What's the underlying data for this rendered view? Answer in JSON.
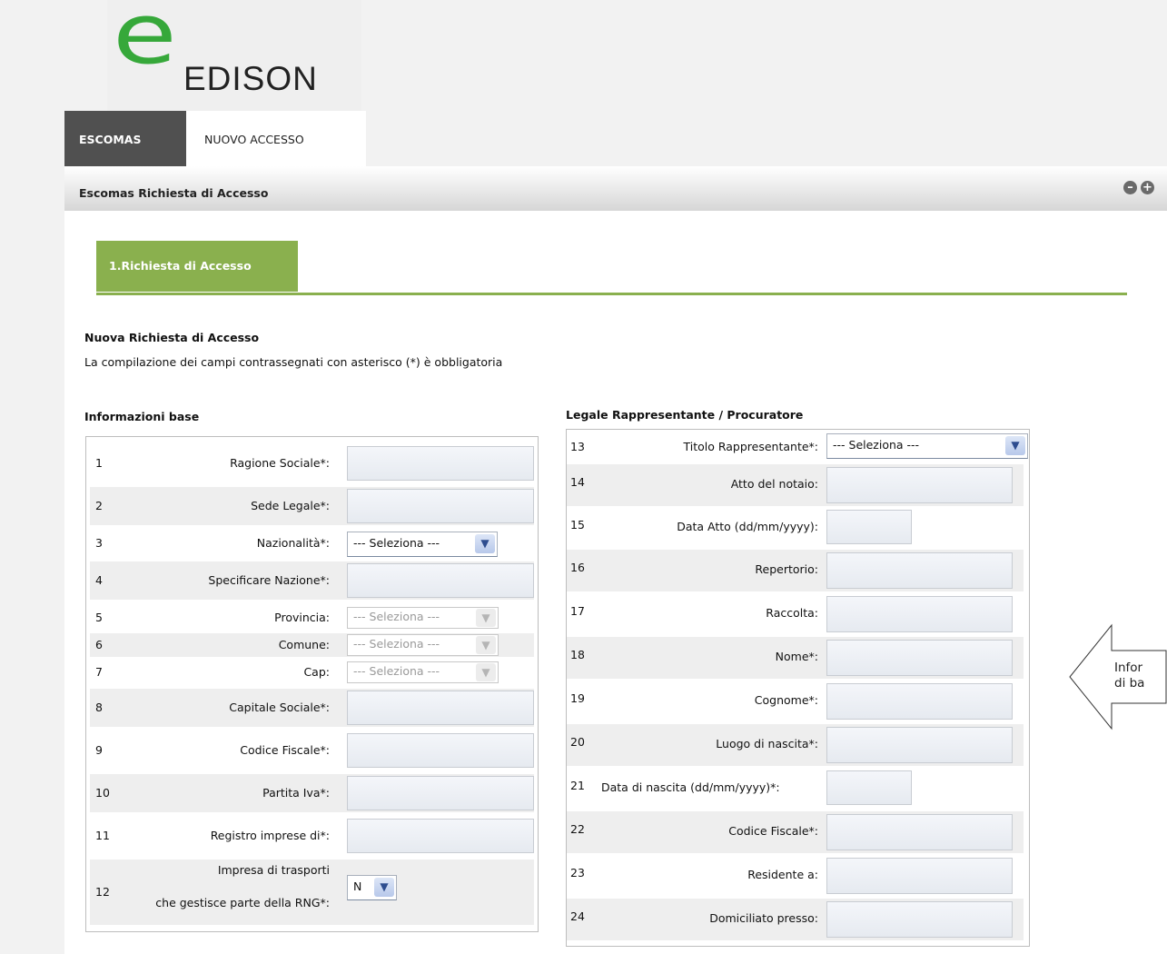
{
  "logo": {
    "mark": "e",
    "text": "EDISON"
  },
  "tabs": [
    {
      "label": "ESCOMAS",
      "active": true
    },
    {
      "label": "NUOVO ACCESSO",
      "active": false
    }
  ],
  "panel": {
    "title": "Escomas Richiesta di Accesso",
    "collapse_icon": "minus-circle-icon",
    "expand_icon": "plus-circle-icon"
  },
  "step_tab": "1.Richiesta di Accesso",
  "heading": "Nuova Richiesta di Accesso",
  "required_note": "La compilazione dei campi contrassegnati con asterisco (*) è obbligatoria",
  "left_section": {
    "title": "Informazioni base",
    "rows": [
      {
        "num": "1",
        "label": "Ragione Sociale*:",
        "type": "text"
      },
      {
        "num": "2",
        "label": "Sede Legale*:",
        "type": "text"
      },
      {
        "num": "3",
        "label": "Nazionalità*:",
        "type": "select",
        "value": "--- Seleziona ---"
      },
      {
        "num": "4",
        "label": "Specificare Nazione*:",
        "type": "text"
      },
      {
        "num": "5",
        "label": "Provincia:",
        "type": "select-disabled",
        "value": "--- Seleziona ---"
      },
      {
        "num": "6",
        "label": "Comune:",
        "type": "select-disabled",
        "value": "--- Seleziona ---"
      },
      {
        "num": "7",
        "label": "Cap:",
        "type": "select-disabled",
        "value": "--- Seleziona ---"
      },
      {
        "num": "8",
        "label": "Capitale Sociale*:",
        "type": "text"
      },
      {
        "num": "9",
        "label": "Codice Fiscale*:",
        "type": "text"
      },
      {
        "num": "10",
        "label": "Partita Iva*:",
        "type": "text"
      },
      {
        "num": "11",
        "label": "Registro imprese di*:",
        "type": "text"
      },
      {
        "num": "12",
        "label_line1": "Impresa di trasporti",
        "label_line2": "che gestisce parte della RNG*:",
        "type": "select-small",
        "value": "N"
      }
    ]
  },
  "right_section": {
    "title": "Legale Rappresentante / Procuratore",
    "rows": [
      {
        "num": "13",
        "label": "Titolo Rappresentante*:",
        "type": "select",
        "value": "--- Seleziona ---"
      },
      {
        "num": "14",
        "label": "Atto del notaio:",
        "type": "text"
      },
      {
        "num": "15",
        "label": "Data Atto (dd/mm/yyyy):",
        "type": "date"
      },
      {
        "num": "16",
        "label": "Repertorio:",
        "type": "text"
      },
      {
        "num": "17",
        "label": "Raccolta:",
        "type": "text"
      },
      {
        "num": "18",
        "label": "Nome*:",
        "type": "text"
      },
      {
        "num": "19",
        "label": "Cognome*:",
        "type": "text"
      },
      {
        "num": "20",
        "label": "Luogo di nascita*:",
        "type": "text"
      },
      {
        "num": "21",
        "label": "Data di nascita (dd/mm/yyyy)*:",
        "type": "date"
      },
      {
        "num": "22",
        "label": "Codice Fiscale*:",
        "type": "text"
      },
      {
        "num": "23",
        "label": "Residente a:",
        "type": "text"
      },
      {
        "num": "24",
        "label": "Domiciliato presso:",
        "type": "text"
      }
    ]
  },
  "callout": {
    "line1": "Infor",
    "line2": "di ba"
  },
  "colors": {
    "accent_green": "#8ab04e",
    "logo_green": "#36a83a",
    "dark_tab": "#505050"
  }
}
